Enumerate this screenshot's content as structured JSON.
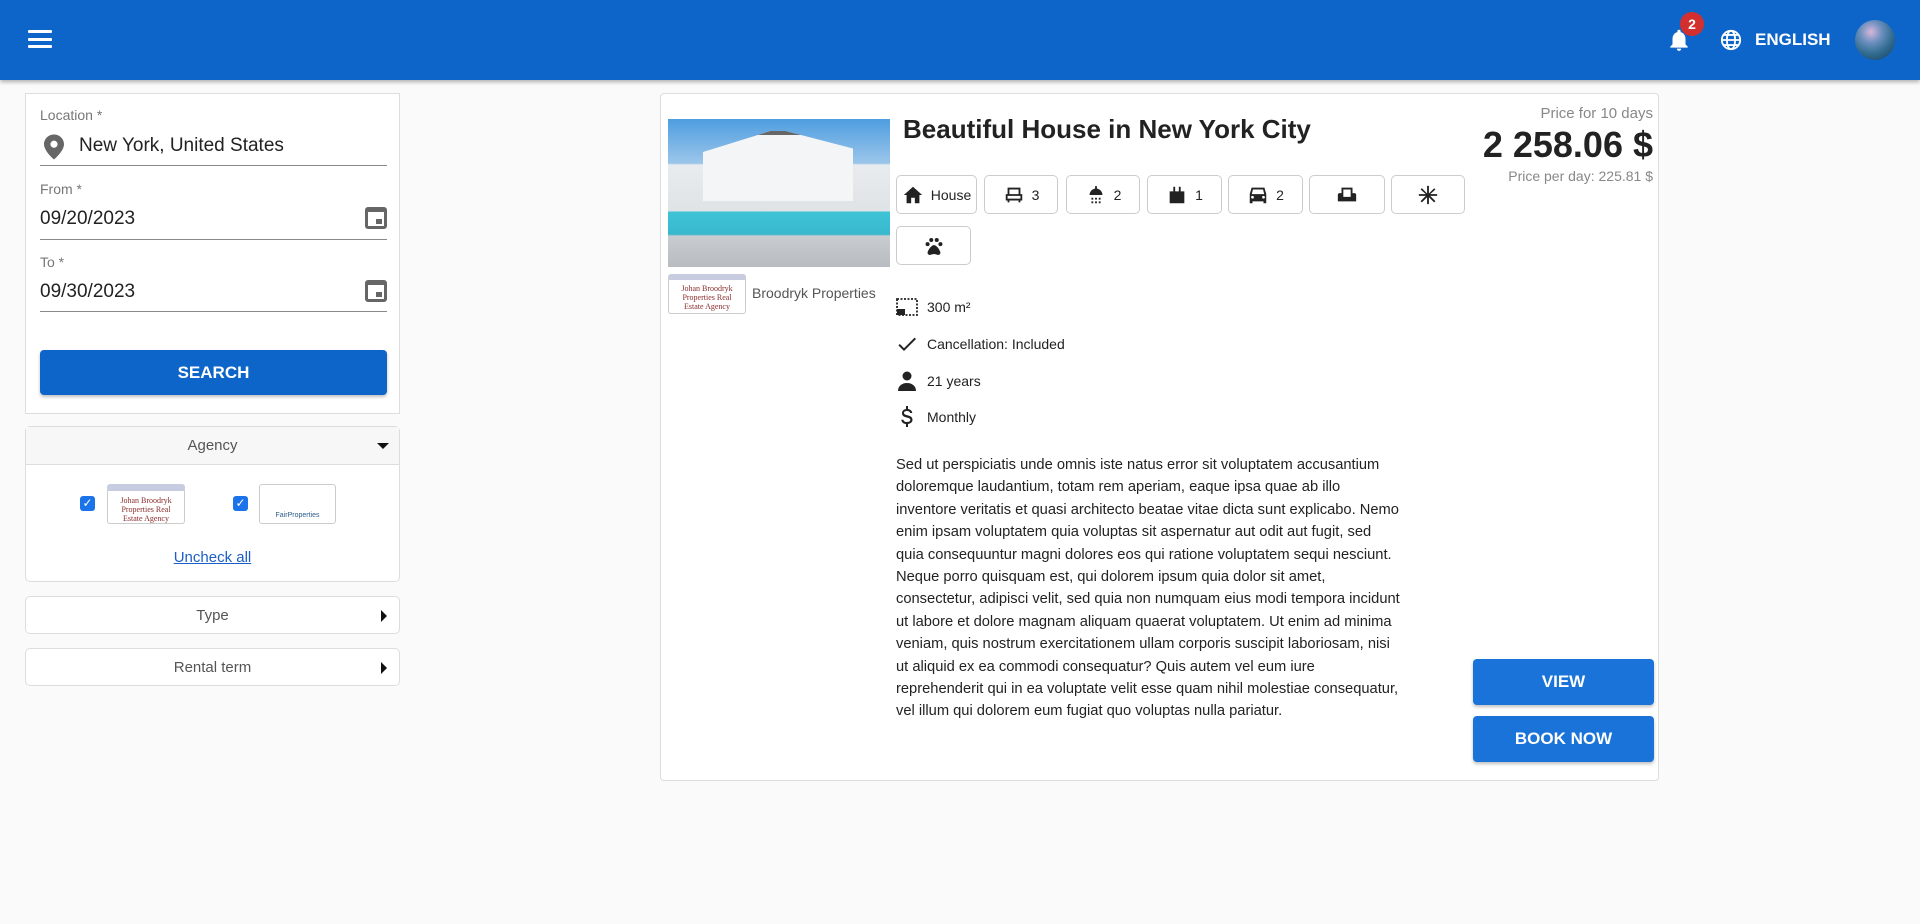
{
  "header": {
    "notifications_count": "2",
    "language": "ENGLISH",
    "colors": {
      "primary": "#0d64c9",
      "badge": "#d32f2f"
    }
  },
  "search_form": {
    "location": {
      "label": "Location *",
      "value": "New York, United States"
    },
    "from": {
      "label": "From *",
      "value": "09/20/2023"
    },
    "to": {
      "label": "To *",
      "value": "09/30/2023"
    },
    "search_label": "SEARCH"
  },
  "filters": {
    "agency": {
      "label": "Agency",
      "agencies": [
        {
          "name": "Johan Broodryk Properties",
          "logo_text": "Johan Broodryk Properties Real Estate Agency",
          "checked": true
        },
        {
          "name": "Fair Properties",
          "logo_text": "FairProperties",
          "checked": true
        }
      ],
      "uncheck_all": "Uncheck all"
    },
    "type": {
      "label": "Type"
    },
    "rental_term": {
      "label": "Rental term"
    }
  },
  "listing": {
    "title": "Beautiful House in New York City",
    "agency_name": "Broodryk Properties",
    "agency_logo_text": "Johan Broodryk Properties Real Estate Agency",
    "features": [
      {
        "icon": "house-icon",
        "value": "House"
      },
      {
        "icon": "bed-icon",
        "value": "3"
      },
      {
        "icon": "shower-icon",
        "value": "2"
      },
      {
        "icon": "kitchen-icon",
        "value": "1"
      },
      {
        "icon": "car-icon",
        "value": "2"
      },
      {
        "icon": "armchair-icon",
        "value": ""
      },
      {
        "icon": "snowflake-icon",
        "value": ""
      },
      {
        "icon": "paw-icon",
        "value": ""
      }
    ],
    "size": "300 m²",
    "cancellation": "Cancellation: Included",
    "min_age": "21 years",
    "rental_term": "Monthly",
    "description": "Sed ut perspiciatis unde omnis iste natus error sit voluptatem accusantium doloremque laudantium, totam rem aperiam, eaque ipsa quae ab illo inventore veritatis et quasi architecto beatae vitae dicta sunt explicabo. Nemo enim ipsam voluptatem quia voluptas sit aspernatur aut odit aut fugit, sed quia consequuntur magni dolores eos qui ratione voluptatem sequi nesciunt. Neque porro quisquam est, qui dolorem ipsum quia dolor sit amet, consectetur, adipisci velit, sed quia non numquam eius modi tempora incidunt ut labore et dolore magnam aliquam quaerat voluptatem. Ut enim ad minima veniam, quis nostrum exercitationem ullam corporis suscipit laboriosam, nisi ut aliquid ex ea commodi consequatur? Quis autem vel eum iure reprehenderit qui in ea voluptate velit esse quam nihil molestiae consequatur, vel illum qui dolorem eum fugiat quo voluptas nulla pariatur.",
    "price_caption": "Price for 10 days",
    "price": "2 258.06 $",
    "price_per_day": "Price per day: 225.81 $",
    "view_label": "VIEW",
    "book_label": "BOOK NOW"
  }
}
